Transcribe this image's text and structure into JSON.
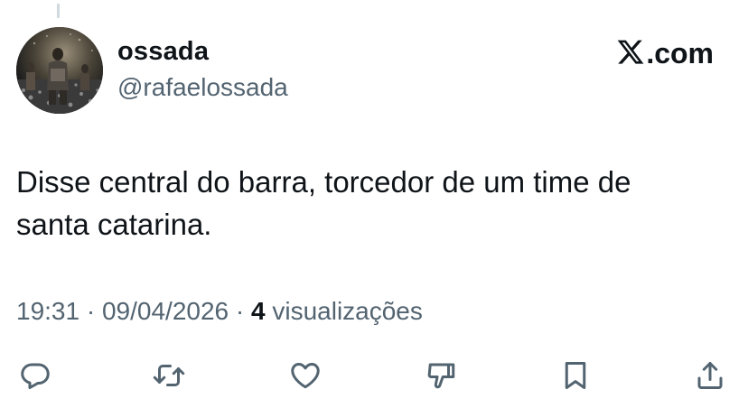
{
  "author": {
    "display_name": "ossada",
    "handle": "@rafaelossada"
  },
  "brand": {
    "logo_icon": "x-logo-icon",
    "suffix": ".com"
  },
  "tweet": {
    "text": "Disse central do barra, torcedor de um time de\nsanta catarina."
  },
  "meta": {
    "time": "19:31",
    "separator": "·",
    "date": "09/04/2026",
    "views_count": "4",
    "views_label": "visualizações"
  },
  "actions": [
    {
      "icon": "reply-icon"
    },
    {
      "icon": "retweet-icon"
    },
    {
      "icon": "like-icon"
    },
    {
      "icon": "dislike-icon"
    },
    {
      "icon": "bookmark-icon"
    },
    {
      "icon": "share-icon"
    }
  ],
  "colors": {
    "text_primary": "#0f1419",
    "text_secondary": "#536471",
    "background": "#ffffff"
  }
}
